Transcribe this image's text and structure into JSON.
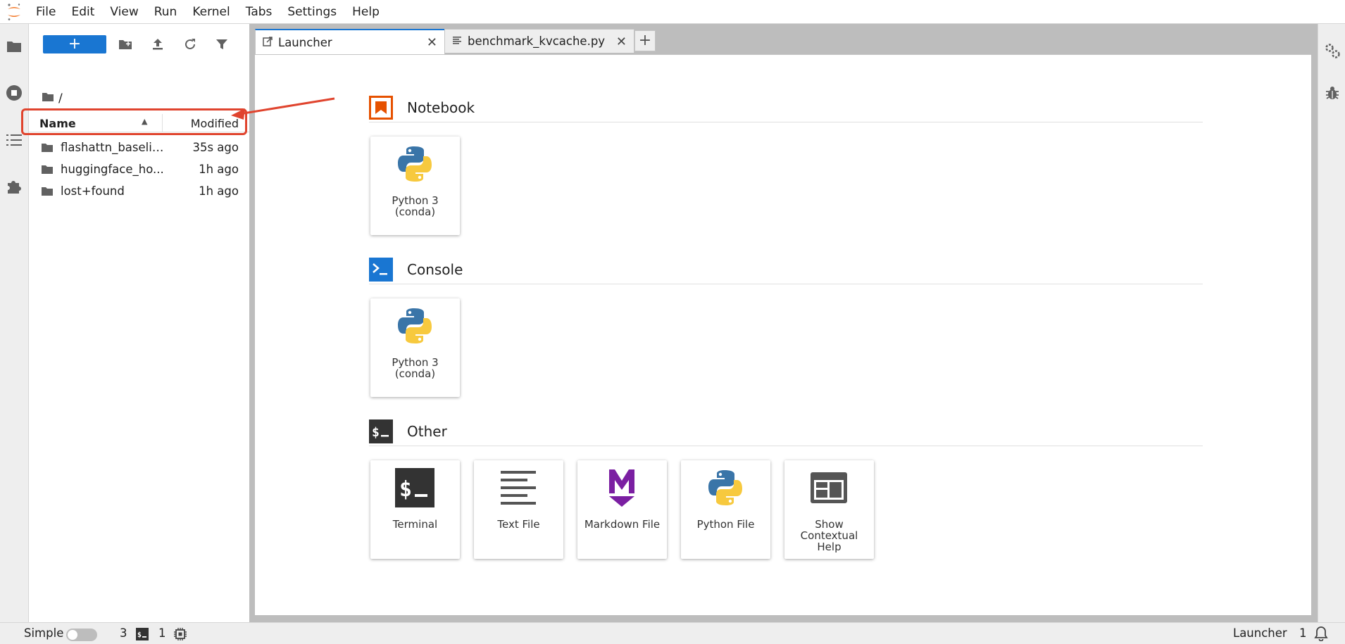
{
  "menubar": {
    "items": [
      "File",
      "Edit",
      "View",
      "Run",
      "Kernel",
      "Tabs",
      "Settings",
      "Help"
    ]
  },
  "filebrowser": {
    "new_button_label": "+",
    "breadcrumb": "/",
    "columns": {
      "name": "Name",
      "modified": "Modified"
    },
    "rows": [
      {
        "name": "flashattn_baseline",
        "modified": "35s ago"
      },
      {
        "name": "huggingface_ho...",
        "modified": "1h ago"
      },
      {
        "name": "lost+found",
        "modified": "1h ago"
      }
    ]
  },
  "tabs": [
    {
      "label": "Launcher",
      "icon": "external-link-icon",
      "active": true
    },
    {
      "label": "benchmark_kvcache.py",
      "icon": "text-file-icon",
      "active": false
    }
  ],
  "launcher": {
    "sections": {
      "notebook": {
        "title": "Notebook",
        "cards": [
          {
            "line1": "Python 3",
            "line2": "(conda)"
          }
        ]
      },
      "console": {
        "title": "Console",
        "cards": [
          {
            "line1": "Python 3",
            "line2": "(conda)"
          }
        ]
      },
      "other": {
        "title": "Other",
        "cards": [
          {
            "label": "Terminal"
          },
          {
            "label": "Text File"
          },
          {
            "label": "Markdown File"
          },
          {
            "label": "Python File"
          },
          {
            "line1": "Show",
            "line2": "Contextual",
            "line3": "Help"
          }
        ]
      }
    }
  },
  "statusbar": {
    "mode_label": "Simple",
    "kernels_count": "3",
    "terminals_count": "1",
    "current_view": "Launcher",
    "notifications_count": "1"
  },
  "colors": {
    "brand_blue": "#1976d2",
    "notebook_orange": "#e65100",
    "console_blue": "#1976d2",
    "annotation_red": "#e0442e"
  }
}
